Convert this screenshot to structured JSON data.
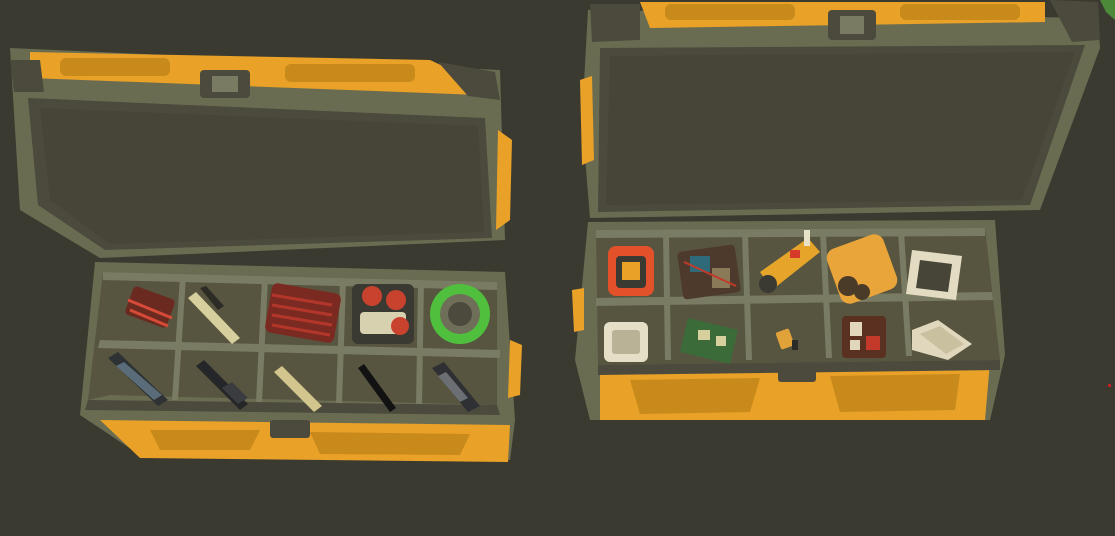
{
  "scene": {
    "colors": {
      "floor": "#3b3a30",
      "crate_orange": "#e9a127",
      "crate_orange_dark": "#c98a1c",
      "frame_olive": "#6a6c52",
      "frame_dark": "#4b4a3c",
      "lid_inside": "#474538",
      "tray": "#57553f",
      "divider": "#7a7b63"
    }
  },
  "crates": [
    {
      "name": "left",
      "items": [
        {
          "name": "red-wire-bundle-item",
          "color": "#a13226"
        },
        {
          "name": "knife-blade-item",
          "color": "#d8cf9e"
        },
        {
          "name": "red-coil-item",
          "color": "#b3362a"
        },
        {
          "name": "capacitor-pack-item",
          "color": "#c9422e"
        },
        {
          "name": "green-tape-roll-item",
          "color": "#4fbf3d"
        },
        {
          "name": "pliers-item",
          "color": "#2f3235"
        },
        {
          "name": "screwdriver-item",
          "color": "#252628"
        },
        {
          "name": "metal-file-item",
          "color": "#d2c58e"
        },
        {
          "name": "black-pen-item",
          "color": "#121212"
        },
        {
          "name": "cutter-item",
          "color": "#2e3033"
        }
      ]
    },
    {
      "name": "right",
      "items": [
        {
          "name": "orange-device-item",
          "color": "#e2512a"
        },
        {
          "name": "circuit-board-item",
          "color": "#2f6a7a"
        },
        {
          "name": "yellow-tool-item",
          "color": "#e6a52a"
        },
        {
          "name": "battery-pack-item",
          "color": "#eaa53a"
        },
        {
          "name": "white-frame-item",
          "color": "#e3dcc2"
        },
        {
          "name": "white-box-item",
          "color": "#e6dfc8"
        },
        {
          "name": "green-pcb-item",
          "color": "#3c6b3a"
        },
        {
          "name": "small-chip-item",
          "color": "#e2a23a"
        },
        {
          "name": "relay-module-item",
          "color": "#5a3020"
        },
        {
          "name": "white-block-item",
          "color": "#e0d7bd"
        }
      ]
    }
  ]
}
